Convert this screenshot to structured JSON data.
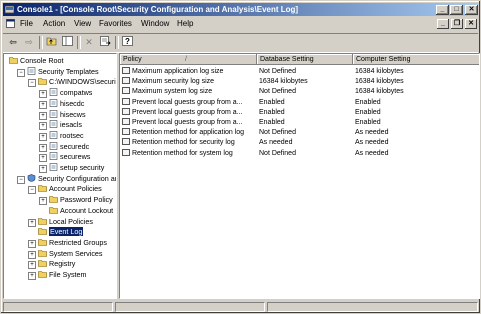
{
  "window": {
    "title": "Console1 - [Console Root\\Security Configuration and Analysis\\Event Log]"
  },
  "menu": [
    "File",
    "Action",
    "View",
    "Favorites",
    "Window",
    "Help"
  ],
  "toolbar": {
    "buttons": [
      "back-icon",
      "forward-icon",
      "up-level-icon",
      "show-hide-tree-icon",
      "delete-icon",
      "export-list-icon",
      "help-icon"
    ]
  },
  "tree": [
    {
      "label": "Console Root",
      "level": 0,
      "expand": "",
      "icon": "folder"
    },
    {
      "label": "Security Templates",
      "level": 1,
      "expand": "-",
      "icon": "template"
    },
    {
      "label": "C:\\WINDOWS\\securi",
      "level": 2,
      "expand": "-",
      "icon": "folder"
    },
    {
      "label": "compatws",
      "level": 3,
      "expand": "+",
      "icon": "template"
    },
    {
      "label": "hisecdc",
      "level": 3,
      "expand": "+",
      "icon": "template"
    },
    {
      "label": "hisecws",
      "level": 3,
      "expand": "+",
      "icon": "template"
    },
    {
      "label": "iesacls",
      "level": 3,
      "expand": "+",
      "icon": "template"
    },
    {
      "label": "rootsec",
      "level": 3,
      "expand": "+",
      "icon": "template"
    },
    {
      "label": "securedc",
      "level": 3,
      "expand": "+",
      "icon": "template"
    },
    {
      "label": "securews",
      "level": 3,
      "expand": "+",
      "icon": "template"
    },
    {
      "label": "setup security",
      "level": 3,
      "expand": "+",
      "icon": "template"
    },
    {
      "label": "Security Configuration ar",
      "level": 1,
      "expand": "-",
      "icon": "shield"
    },
    {
      "label": "Account Policies",
      "level": 2,
      "expand": "-",
      "icon": "folder"
    },
    {
      "label": "Password Policy",
      "level": 3,
      "expand": "+",
      "icon": "folder"
    },
    {
      "label": "Account Lockout",
      "level": 3,
      "expand": "",
      "icon": "folder"
    },
    {
      "label": "Local Policies",
      "level": 2,
      "expand": "+",
      "icon": "folder"
    },
    {
      "label": "Event Log",
      "level": 2,
      "expand": "",
      "icon": "folder",
      "selected": true
    },
    {
      "label": "Restricted Groups",
      "level": 2,
      "expand": "+",
      "icon": "folder"
    },
    {
      "label": "System Services",
      "level": 2,
      "expand": "+",
      "icon": "folder"
    },
    {
      "label": "Registry",
      "level": 2,
      "expand": "+",
      "icon": "folder"
    },
    {
      "label": "File System",
      "level": 2,
      "expand": "+",
      "icon": "folder"
    }
  ],
  "list": {
    "columns": [
      "Policy",
      "/",
      "Database Setting",
      "Computer Setting"
    ],
    "rows": [
      {
        "policy": "Maximum application log size",
        "db": "Not Defined",
        "comp": "16384 kilobytes"
      },
      {
        "policy": "Maximum security log size",
        "db": "16384 kilobytes",
        "comp": "16384 kilobytes"
      },
      {
        "policy": "Maximum system log size",
        "db": "Not Defined",
        "comp": "16384 kilobytes"
      },
      {
        "policy": "Prevent local guests group from a...",
        "db": "Enabled",
        "comp": "Enabled"
      },
      {
        "policy": "Prevent local guests group from a...",
        "db": "Enabled",
        "comp": "Enabled"
      },
      {
        "policy": "Prevent local guests group from a...",
        "db": "Enabled",
        "comp": "Enabled"
      },
      {
        "policy": "Retention method for application log",
        "db": "Not Defined",
        "comp": "As needed"
      },
      {
        "policy": "Retention method for security log",
        "db": "As needed",
        "comp": "As needed"
      },
      {
        "policy": "Retention method for system log",
        "db": "Not Defined",
        "comp": "As needed"
      }
    ]
  },
  "colors": {
    "title_start": "#0a246a",
    "title_end": "#a6caf0",
    "face": "#d4d0c8",
    "selection": "#0a246a"
  }
}
